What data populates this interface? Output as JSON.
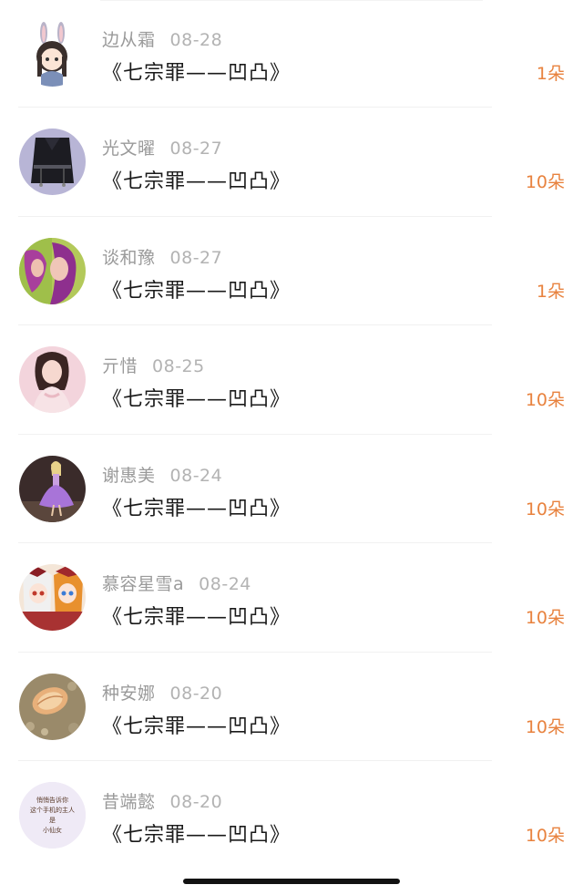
{
  "gifts": [
    {
      "name": "边从霜",
      "date": "08-28",
      "title": "《七宗罪——凹凸》",
      "amount": "1朵",
      "avatar": "bunny-girl-avatar"
    },
    {
      "name": "光文曜",
      "date": "08-27",
      "title": "《七宗罪——凹凸》",
      "amount": "10朵",
      "avatar": "dark-outfit-avatar"
    },
    {
      "name": "谈和豫",
      "date": "08-27",
      "title": "《七宗罪——凹凸》",
      "amount": "1朵",
      "avatar": "purple-hair-avatar"
    },
    {
      "name": "亓惜",
      "date": "08-25",
      "title": "《七宗罪——凹凸》",
      "amount": "10朵",
      "avatar": "woman-portrait-avatar"
    },
    {
      "name": "谢惠美",
      "date": "08-24",
      "title": "《七宗罪——凹凸》",
      "amount": "10朵",
      "avatar": "purple-dress-avatar"
    },
    {
      "name": "慕容星雪a",
      "date": "08-24",
      "title": "《七宗罪——凹凸》",
      "amount": "10朵",
      "avatar": "anime-duo-avatar"
    },
    {
      "name": "种安娜",
      "date": "08-20",
      "title": "《七宗罪——凹凸》",
      "amount": "10朵",
      "avatar": "seashell-avatar"
    },
    {
      "name": "昔端懿",
      "date": "08-20",
      "title": "《七宗罪——凹凸》",
      "amount": "10朵",
      "avatar": "text-card-avatar",
      "avatar_text": [
        "悄悄告诉你",
        "这个手机的主人",
        "是",
        "小仙女"
      ]
    }
  ],
  "colors": {
    "amount": "#e8823e",
    "name": "#9a9a9a",
    "title": "#1a1a1a"
  }
}
